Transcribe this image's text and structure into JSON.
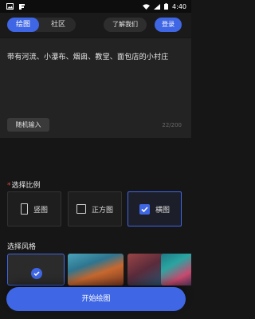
{
  "status_bar": {
    "time": "4:40"
  },
  "header": {
    "tabs": [
      {
        "label": "绘图"
      },
      {
        "label": "社区"
      }
    ],
    "about_label": "了解我们",
    "login_label": "登录"
  },
  "prompt": {
    "text": "带有河流、小瀑布、烟囱、教堂、面包店的小村庄",
    "random_label": "随机输入",
    "counter": "22/200"
  },
  "ratio_section": {
    "title": "选择比例",
    "options": [
      {
        "label": "竖图",
        "selected": false
      },
      {
        "label": "正方图",
        "selected": false
      },
      {
        "label": "横图",
        "selected": true
      }
    ]
  },
  "style_section": {
    "title": "选择风格"
  },
  "start_label": "开始绘图",
  "colors": {
    "accent": "#3f66e4",
    "background": "#161616",
    "panel": "#232323"
  }
}
